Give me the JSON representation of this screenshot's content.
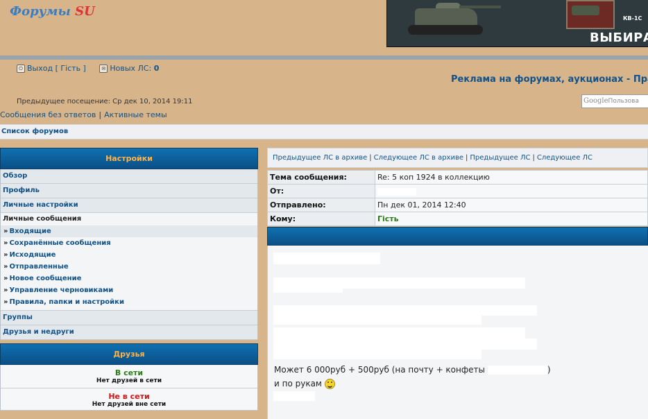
{
  "header": {
    "logo_text": "Форумы",
    "logo_suffix": "SU",
    "banner": {
      "tank_label": "КВ-1С",
      "cta": "ВЫБИРАЙ"
    }
  },
  "user_bar": {
    "logout": "Выход [ Гість ]",
    "new_pm_label": "Новых ЛС:",
    "new_pm_count": "0"
  },
  "ad_text": "Реклама на форумах, аукционах - Прав",
  "last_visit": "Предыдущее посещение: Ср дек 10, 2014 19:11",
  "search": {
    "brand": "Google",
    "placeholder": "Пользова"
  },
  "quick_links": {
    "unanswered": "Сообщения без ответов",
    "active": "Активные темы"
  },
  "breadcrumb": "Список форумов",
  "sidebar": {
    "settings_title": "Настройки",
    "items": [
      "Обзор",
      "Профиль",
      "Личные настройки"
    ],
    "private_messages_title": "Личные сообщения",
    "sub_items": [
      "Входящие",
      "Сохранённые сообщения",
      "Исходящие",
      "Отправленные",
      "Новое сообщение",
      "Управление черновиками",
      "Правила, папки и настройки"
    ],
    "bottom_items": [
      "Группы",
      "Друзья и недруги"
    ],
    "friends_title": "Друзья",
    "online": "В сети",
    "no_online": "Нет друзей в сети",
    "offline": "Не в сети",
    "no_offline": "Нет друзей вне сети"
  },
  "pm_nav": [
    "Предыдущее ЛС в архиве",
    "Следующее ЛС в архиве",
    "Предыдущее ЛС",
    "Следующее ЛС"
  ],
  "pm_details": {
    "subject_label": "Тема сообщения:",
    "subject": "Re: 5 коп 1924 в коллекцию",
    "from_label": "От:",
    "sent_label": "Отправлено:",
    "sent": "Пн дек 01, 2014 12:40",
    "to_label": "Кому:",
    "to": "Гість"
  },
  "pm_body": {
    "line1": "Может 6 000руб + 500руб (на почту + конфеты",
    "line1_end": ")",
    "line2": "и по рукам"
  },
  "colors": {
    "background": "#d8b48a",
    "link": "#105289",
    "header_blue": "#0b5c99",
    "accent_orange": "#ffb44a",
    "online_green": "#2a7d15",
    "offline_red": "#d21414"
  }
}
